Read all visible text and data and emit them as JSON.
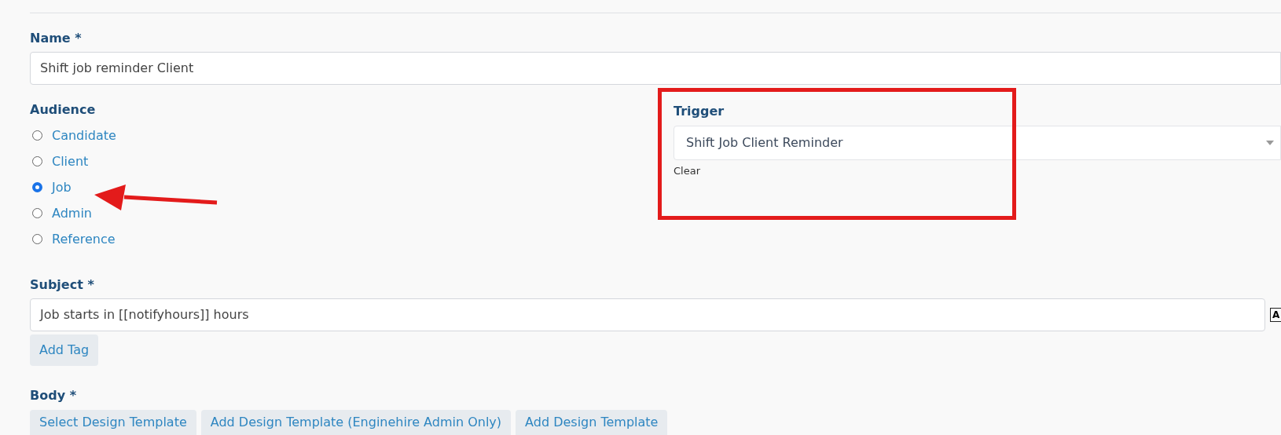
{
  "name_field": {
    "label": "Name *",
    "value": "Shift job reminder Client"
  },
  "audience": {
    "label": "Audience",
    "options": [
      {
        "label": "Candidate",
        "selected": false
      },
      {
        "label": "Client",
        "selected": false
      },
      {
        "label": "Job",
        "selected": true
      },
      {
        "label": "Admin",
        "selected": false
      },
      {
        "label": "Reference",
        "selected": false
      }
    ]
  },
  "trigger": {
    "label": "Trigger",
    "value": "Shift Job Client Reminder",
    "clear": "Clear"
  },
  "subject": {
    "label": "Subject *",
    "value": "Job starts in [[notifyhours]] hours",
    "badge": "A",
    "add_tag": "Add Tag"
  },
  "body": {
    "label": "Body *",
    "buttons": [
      "Select Design Template",
      "Add Design Template (Enginehire Admin Only)",
      "Add Design Template"
    ]
  }
}
